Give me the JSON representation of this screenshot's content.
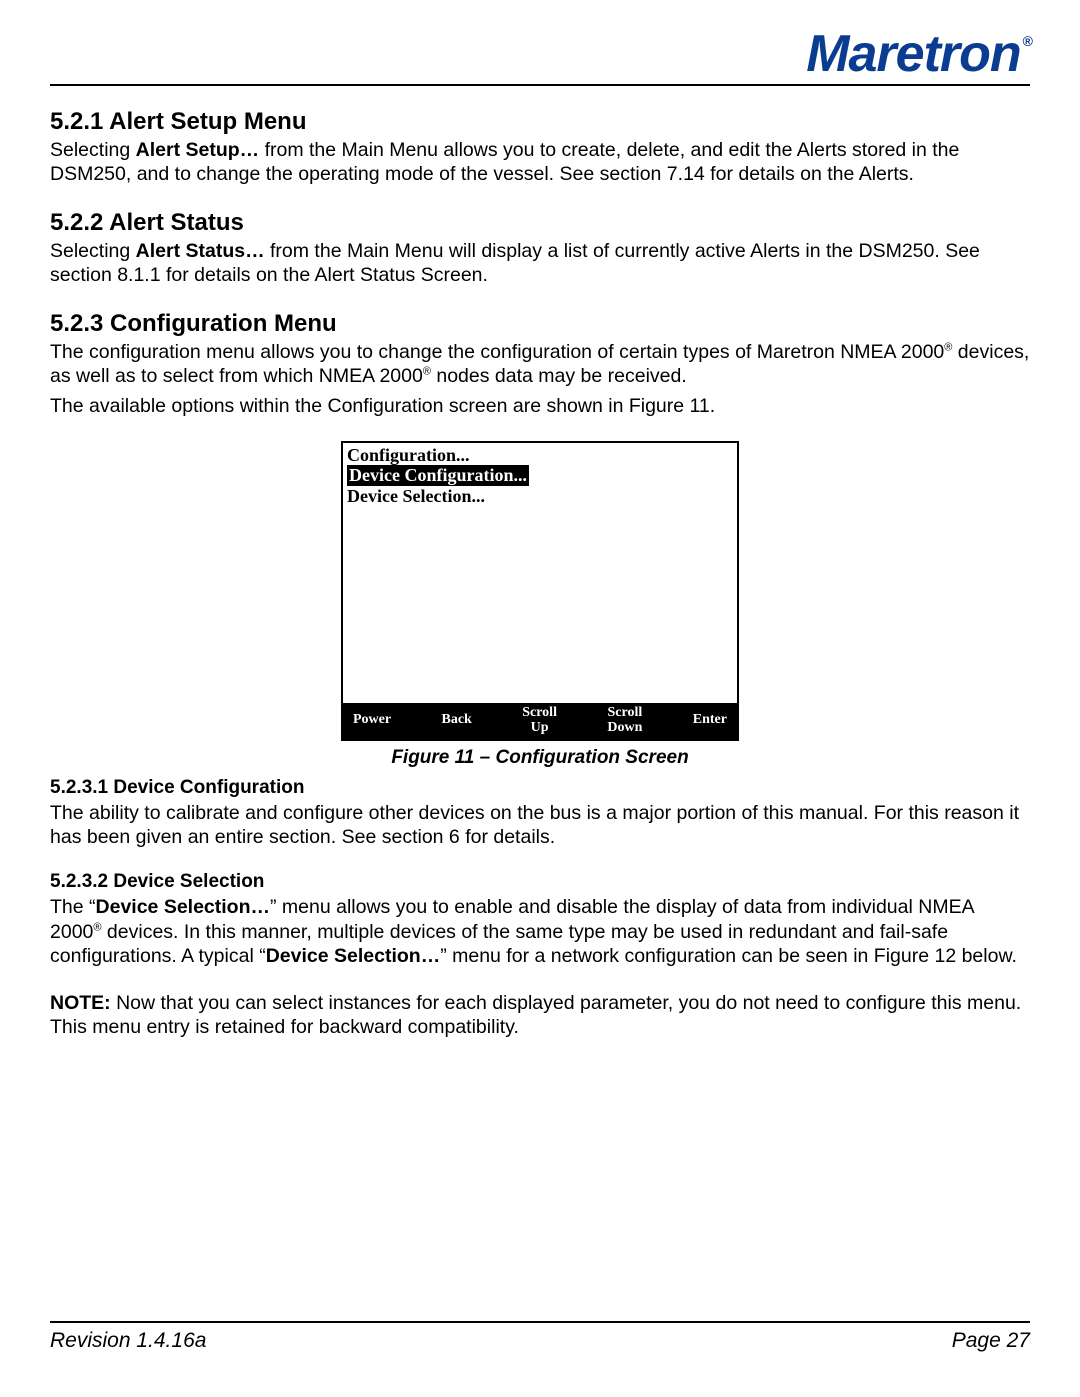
{
  "logo": {
    "text": "Maretron",
    "reg": "®"
  },
  "sections": {
    "s1": {
      "heading": "5.2.1  Alert Setup Menu",
      "para_a": "Selecting ",
      "para_b_bold": "Alert Setup…",
      "para_c": " from the Main Menu allows you to create, delete, and edit the Alerts stored in the DSM250, and to change the operating mode of the vessel. See section 7.14 for details on the Alerts."
    },
    "s2": {
      "heading": "5.2.2  Alert Status",
      "para_a": "Selecting ",
      "para_b_bold": "Alert Status…",
      "para_c": " from the Main Menu will display a list of currently active Alerts in the DSM250.  See section 8.1.1 for details on the Alert Status Screen."
    },
    "s3": {
      "heading": "5.2.3  Configuration Menu",
      "para1_a": "The configuration menu allows you to change the configuration of certain types of Maretron NMEA 2000",
      "para1_b": " devices, as well as to select from which NMEA 2000",
      "para1_c": " nodes data may be received.",
      "para2": "The available options within the Configuration screen are shown in Figure 11."
    },
    "screen": {
      "title": "Configuration...",
      "item_selected": "Device  Configuration...",
      "item2": "Device  Selection...",
      "buttons": {
        "power": "Power",
        "back": "Back",
        "scrollup1": "Scroll",
        "scrollup2": "Up",
        "scrolldown1": "Scroll",
        "scrolldown2": "Down",
        "enter": "Enter"
      }
    },
    "figcaption": "Figure 11 – Configuration Screen",
    "s3_1": {
      "heading": "5.2.3.1  Device Configuration",
      "para": "The ability to calibrate and configure other devices on the bus is a major portion of this manual. For this reason it has been given an entire section. See section 6 for details."
    },
    "s3_2": {
      "heading": "5.2.3.2  Device Selection",
      "p_a": "The “",
      "p_b_bold": "Device Selection…",
      "p_c": "” menu allows you to enable and disable the display of data from individual NMEA 2000",
      "p_d": " devices. In this manner, multiple devices of the same type may be used in redundant and fail-safe configurations. A typical “",
      "p_e_bold": "Device Selection…",
      "p_f": "” menu for a network configuration can be seen in Figure 12 below.",
      "note_label": "NOTE:",
      "note_body": " Now that you can select instances for each displayed parameter, you do not need to configure this menu. This menu entry is retained for backward compatibility."
    }
  },
  "footer": {
    "revision": "Revision 1.4.16a",
    "page": "Page 27"
  },
  "reg_symbol": "®"
}
